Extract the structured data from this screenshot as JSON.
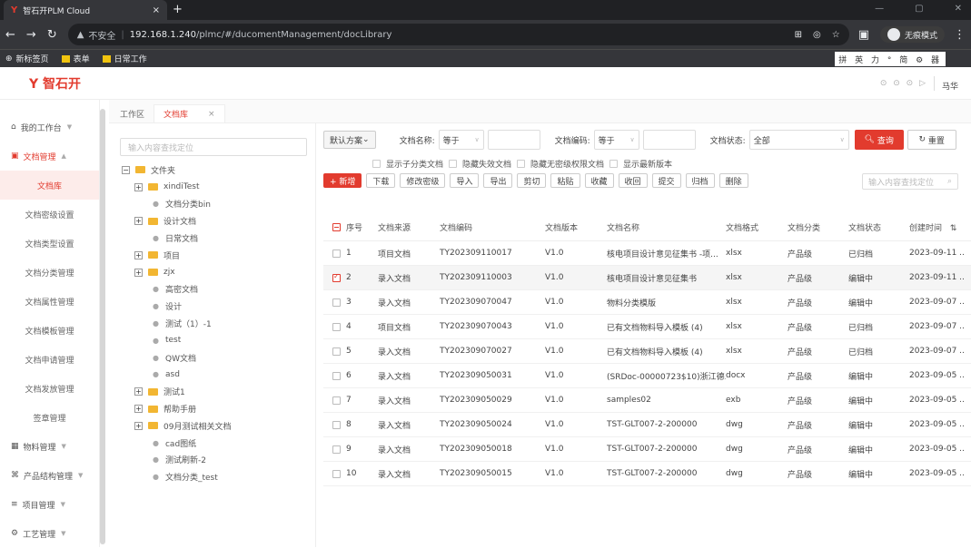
{
  "browser": {
    "tab_title": "智石开PLM Cloud",
    "tab_favicon": "Y",
    "tab_close": "×",
    "new_tab": "+",
    "url_warning": "不安全",
    "url_host": "192.168.1.240",
    "url_path": "/plmc/#/ducomentManagement/docLibrary",
    "incognito_label": "无痕模式",
    "bookmarks": [
      "新标签页",
      "表单",
      "日常工作"
    ],
    "ime_text": "拼 英 力 ° 简 ⚙ 器"
  },
  "header": {
    "logo": "Y 智石开",
    "icons": "⊙ ⊙ ⊙ ▷",
    "user": "马华"
  },
  "sidebar": {
    "groups_top": [
      {
        "icon": "⌂",
        "label": "我的工作台"
      },
      {
        "icon": "▣",
        "label": "文档管理"
      }
    ],
    "subitems": [
      "文档库",
      "文档密级设置",
      "文档类型设置",
      "文档分类管理",
      "文档属性管理",
      "文档模板管理",
      "文档申请管理",
      "文档发放管理",
      "签章管理"
    ],
    "groups_bottom": [
      {
        "icon": "▦",
        "label": "物料管理"
      },
      {
        "icon": "⌘",
        "label": "产品结构管理"
      },
      {
        "icon": "≡",
        "label": "项目管理"
      },
      {
        "icon": "⚙",
        "label": "工艺管理"
      }
    ]
  },
  "content_tabs": [
    {
      "label": "工作区"
    },
    {
      "label": "文档库",
      "close": "×"
    }
  ],
  "tree": {
    "search_placeholder": "输入内容查找定位",
    "root": "文件夹",
    "nodes": [
      {
        "label": "xindiTest",
        "level": 1,
        "type": "folder"
      },
      {
        "label": "文档分类bin",
        "level": 2,
        "type": "leaf"
      },
      {
        "label": "设计文档",
        "level": 1,
        "type": "folder"
      },
      {
        "label": "日常文档",
        "level": 2,
        "type": "leaf"
      },
      {
        "label": "项目",
        "level": 1,
        "type": "folder"
      },
      {
        "label": "zjx",
        "level": 1,
        "type": "folder"
      },
      {
        "label": "高密文档",
        "level": 2,
        "type": "leaf"
      },
      {
        "label": "设计",
        "level": 2,
        "type": "leaf"
      },
      {
        "label": "测试（1）-1",
        "level": 2,
        "type": "leaf"
      },
      {
        "label": "test",
        "level": 2,
        "type": "leaf"
      },
      {
        "label": "QW文档",
        "level": 2,
        "type": "leaf"
      },
      {
        "label": "asd",
        "level": 2,
        "type": "leaf"
      },
      {
        "label": "测试1",
        "level": 1,
        "type": "folder"
      },
      {
        "label": "帮助手册",
        "level": 1,
        "type": "folder"
      },
      {
        "label": "09月测试相关文档",
        "level": 1,
        "type": "folder"
      },
      {
        "label": "cad图纸",
        "level": 2,
        "type": "leaf"
      },
      {
        "label": "测试刷新-2",
        "level": 2,
        "type": "leaf"
      },
      {
        "label": "文档分类_test",
        "level": 2,
        "type": "leaf"
      }
    ]
  },
  "filters": {
    "scheme": "默认方案",
    "name_label": "文档名称:",
    "name_op": "等于",
    "code_label": "文档编码:",
    "code_op": "等于",
    "status_label": "文档状态:",
    "status_value": "全部",
    "query": "查询",
    "reset": "重置",
    "checks": [
      "显示子分类文档",
      "隐藏失效文档",
      "隐藏无密级权限文档",
      "显示最新版本"
    ]
  },
  "actions": {
    "buttons": [
      "+ 新增",
      "下载",
      "修改密级",
      "导入",
      "导出",
      "剪切",
      "粘贴",
      "收藏",
      "收回",
      "提交",
      "归档",
      "删除"
    ],
    "search_placeholder": "输入内容查找定位"
  },
  "table": {
    "headers": [
      "序号",
      "文档来源",
      "文档编码",
      "文档版本",
      "文档名称",
      "文档格式",
      "文档分类",
      "文档状态",
      "创建时间"
    ],
    "rows": [
      {
        "no": "1",
        "src": "项目文档",
        "code": "TY202309110017",
        "ver": "V1.0",
        "name": "核电项目设计意见征集书 -项...",
        "fmt": "xlsx",
        "cat": "产品级",
        "status": "已归档",
        "time": "2023-09-11 ..",
        "checked": false
      },
      {
        "no": "2",
        "src": "录入文档",
        "code": "TY202309110003",
        "ver": "V1.0",
        "name": "核电项目设计意见征集书",
        "fmt": "xlsx",
        "cat": "产品级",
        "status": "编辑中",
        "time": "2023-09-11 ..",
        "checked": true
      },
      {
        "no": "3",
        "src": "录入文档",
        "code": "TY202309070047",
        "ver": "V1.0",
        "name": "物料分类模版",
        "fmt": "xlsx",
        "cat": "产品级",
        "status": "编辑中",
        "time": "2023-09-07 ..",
        "checked": false
      },
      {
        "no": "4",
        "src": "项目文档",
        "code": "TY202309070043",
        "ver": "V1.0",
        "name": "已有文档物料导入模板 (4)",
        "fmt": "xlsx",
        "cat": "产品级",
        "status": "已归档",
        "time": "2023-09-07 ..",
        "checked": false
      },
      {
        "no": "5",
        "src": "录入文档",
        "code": "TY202309070027",
        "ver": "V1.0",
        "name": "已有文档物料导入模板 (4)",
        "fmt": "xlsx",
        "cat": "产品级",
        "status": "已归档",
        "time": "2023-09-07 ..",
        "checked": false
      },
      {
        "no": "6",
        "src": "录入文档",
        "code": "TY202309050031",
        "ver": "V1.0",
        "name": "(SRDoc-00000723$10)浙江德...",
        "fmt": "docx",
        "cat": "产品级",
        "status": "编辑中",
        "time": "2023-09-05 ..",
        "checked": false
      },
      {
        "no": "7",
        "src": "录入文档",
        "code": "TY202309050029",
        "ver": "V1.0",
        "name": "samples02",
        "fmt": "exb",
        "cat": "产品级",
        "status": "编辑中",
        "time": "2023-09-05 ..",
        "checked": false
      },
      {
        "no": "8",
        "src": "录入文档",
        "code": "TY202309050024",
        "ver": "V1.0",
        "name": "TST-GLT007-2-200000",
        "fmt": "dwg",
        "cat": "产品级",
        "status": "编辑中",
        "time": "2023-09-05 ..",
        "checked": false
      },
      {
        "no": "9",
        "src": "录入文档",
        "code": "TY202309050018",
        "ver": "V1.0",
        "name": "TST-GLT007-2-200000",
        "fmt": "dwg",
        "cat": "产品级",
        "status": "编辑中",
        "time": "2023-09-05 ..",
        "checked": false
      },
      {
        "no": "10",
        "src": "录入文档",
        "code": "TY202309050015",
        "ver": "V1.0",
        "name": "TST-GLT007-2-200000",
        "fmt": "dwg",
        "cat": "产品级",
        "status": "编辑中",
        "time": "2023-09-05 ..",
        "checked": false
      }
    ]
  },
  "colors": {
    "accent": "#e23b2e",
    "folder": "#f2b632"
  }
}
